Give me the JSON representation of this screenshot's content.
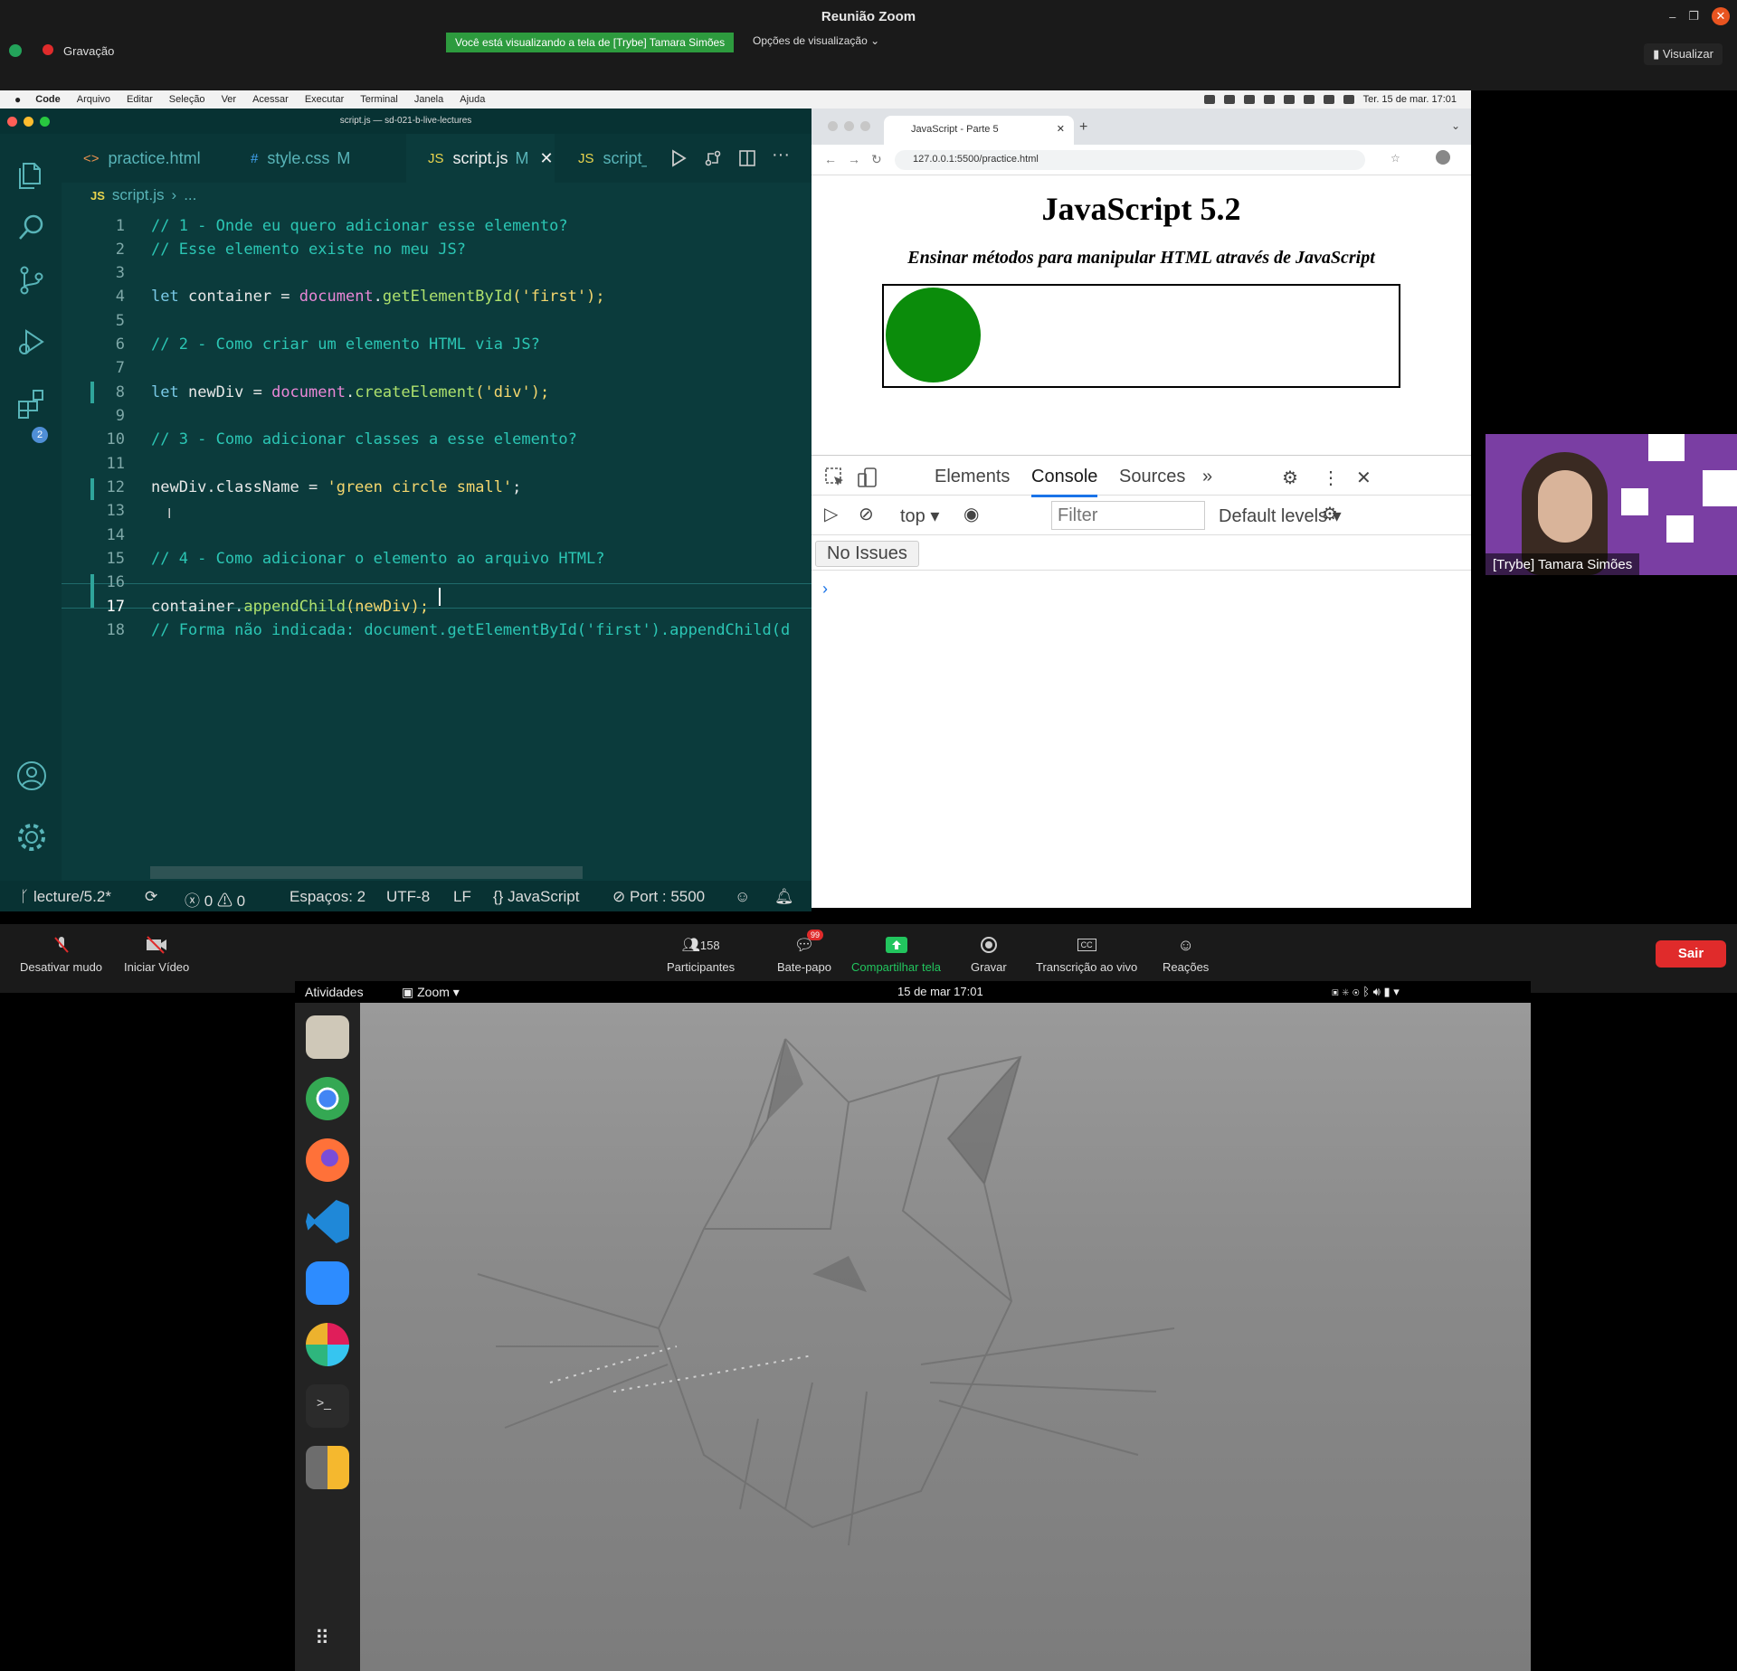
{
  "zoom": {
    "window_title": "Reunião Zoom",
    "recording_label": "Gravação",
    "share_banner": "Você está visualizando a tela de [Trybe] Tamara Simões",
    "view_options": "Opções de visualização",
    "visualize_button": "Visualizar",
    "participant_name": "[Trybe] Tamara Simões",
    "controls": {
      "mute": "Desativar mudo",
      "video": "Iniciar Vídeo",
      "participants_count": "158",
      "participants": "Participantes",
      "chat_badge": "99",
      "chat": "Bate-papo",
      "share": "Compartilhar tela",
      "record": "Gravar",
      "transcription": "Transcrição ao vivo",
      "reactions": "Reações",
      "leave": "Sair"
    }
  },
  "mac": {
    "menubar": [
      "Code",
      "Arquivo",
      "Editar",
      "Seleção",
      "Ver",
      "Acessar",
      "Executar",
      "Terminal",
      "Janela",
      "Ajuda"
    ],
    "clock": "Ter. 15 de mar. 17:01"
  },
  "vscode": {
    "window_title": "script.js — sd-021-b-live-lectures",
    "tabs": [
      {
        "icon": "<>",
        "label": "practice.html",
        "modified": ""
      },
      {
        "icon": "#",
        "label": "style.css",
        "modified": "M"
      },
      {
        "icon": "JS",
        "label": "script.js",
        "modified": "M"
      },
      {
        "icon": "JS",
        "label": "script_",
        "modified": ""
      }
    ],
    "breadcrumb_file": "script.js",
    "breadcrumb_rest": "...",
    "breadcrumb_icon": "JS",
    "scm_badge": "2",
    "line_numbers": [
      "1",
      "2",
      "3",
      "4",
      "5",
      "6",
      "7",
      "8",
      "9",
      "10",
      "11",
      "12",
      "13",
      "14",
      "15",
      "16",
      "17",
      "18"
    ],
    "code": {
      "l1": "// 1 - Onde eu quero adicionar esse elemento?",
      "l2": "// Esse elemento existe no meu JS?",
      "l4_let": "let",
      "l4_var": " container = ",
      "l4_obj": "document",
      "l4_fn": "getElementById",
      "l4_arg": "'first'",
      "l6": "// 2 - Como criar um elemento HTML via JS?",
      "l8_let": "let",
      "l8_var": " newDiv = ",
      "l8_obj": "document",
      "l8_fn": "createElement",
      "l8_arg": "'div'",
      "l10": "// 3 - Como adicionar classes a esse elemento?",
      "l12_a": "newDiv.className = ",
      "l12_str": "'green circle small'",
      "l15": "// 4 - Como adicionar o elemento ao arquivo HTML?",
      "l17_a": "container.",
      "l17_fn": "appendChild",
      "l17_b": "(newDiv);",
      "l18": "// Forma não indicada: document.getElementById('first').appendChild(d"
    },
    "status": {
      "branch": "lecture/5.2*",
      "errors": "0",
      "warnings": "0",
      "spaces": "Espaços: 2",
      "encoding": "UTF-8",
      "eol": "LF",
      "language": "JavaScript",
      "port": "Port : 5500"
    }
  },
  "browser": {
    "tab_title": "JavaScript - Parte 5",
    "url": "127.0.0.1:5500/practice.html",
    "page_title": "JavaScript 5.2",
    "page_subtitle": "Ensinar métodos para manipular HTML através de JavaScript",
    "devtools": {
      "tabs": [
        "Elements",
        "Console",
        "Sources"
      ],
      "context": "top",
      "filter_placeholder": "Filter",
      "levels": "Default levels",
      "issues": "No Issues"
    }
  },
  "ubuntu": {
    "activities": "Atividades",
    "app": "Zoom",
    "clock": "15 de mar  17:01"
  },
  "colors": {
    "vscode_bg": "#0b3b3c",
    "comment": "#2bc6b4",
    "zoom_red": "#e02b2b",
    "share_green": "#2d9b3e",
    "circle_green": "#0b8c0b"
  }
}
